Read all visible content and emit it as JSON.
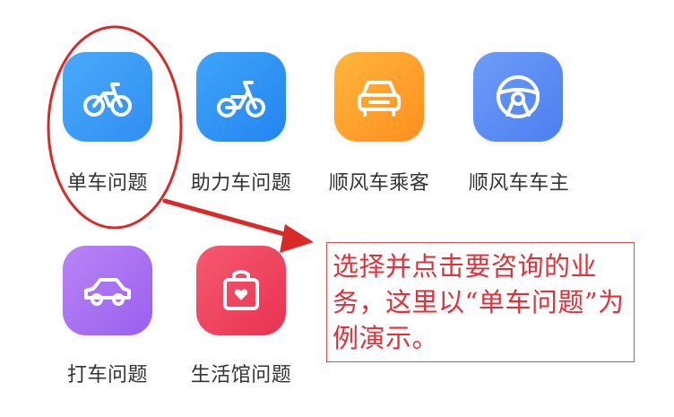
{
  "apps": {
    "row1": [
      {
        "label": "单车问题",
        "icon": "bicycle-icon",
        "color": "#3b9bf5"
      },
      {
        "label": "助力车问题",
        "icon": "ebike-icon",
        "color": "#2f95f6"
      },
      {
        "label": "顺风车乘客",
        "icon": "car-front-icon",
        "color": "#ff9f2a"
      },
      {
        "label": "顺风车车主",
        "icon": "steering-wheel-icon",
        "color": "#5a8ff5"
      }
    ],
    "row2": [
      {
        "label": "打车问题",
        "icon": "car-side-icon",
        "color": "#a36cf2"
      },
      {
        "label": "生活馆问题",
        "icon": "shopping-bag-heart-icon",
        "color": "#f0405b"
      }
    ]
  },
  "annotation": {
    "text": "选择并点击要咨询的业务，这里以“单车问题”为例演示。",
    "color": "#e0313a"
  }
}
